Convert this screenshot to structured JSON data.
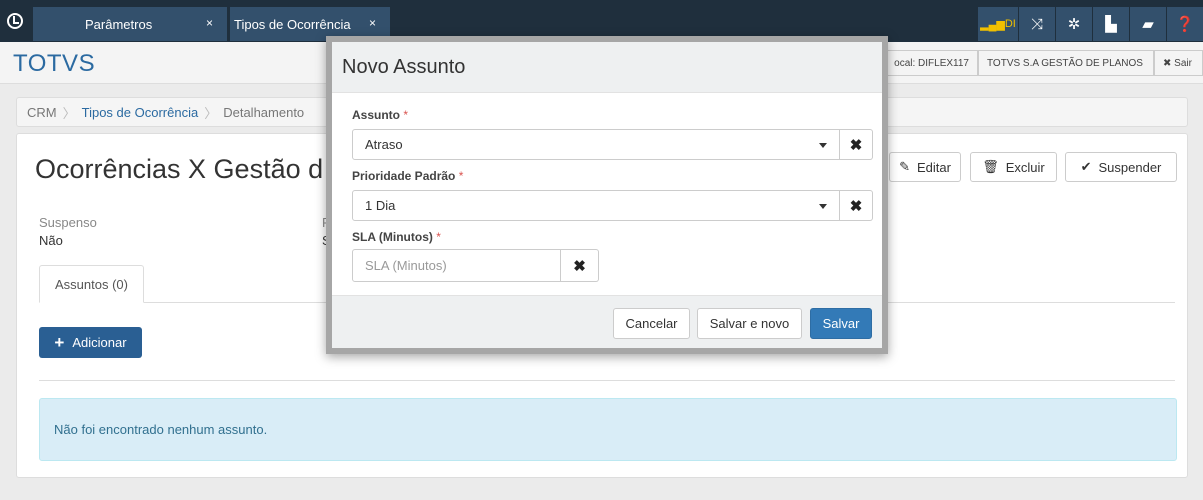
{
  "topbar": {
    "tabs": [
      {
        "label": "Parâmetros",
        "close": "×"
      },
      {
        "label": "Tipos de Ocorrência",
        "close": "×"
      }
    ],
    "icons": [
      "signal-icon",
      "shuffle-icon",
      "gear-icon",
      "document-icon",
      "chat-icon",
      "help-icon"
    ],
    "signal_label": "DI"
  },
  "header": {
    "brand": "TOTVS",
    "local": "ocal: DIFLEX117",
    "company": "TOTVS S.A GESTÃO DE PLANOS",
    "logout": "✖ Sair"
  },
  "breadcrumb": {
    "items": [
      "CRM",
      "Tipos de Ocorrência",
      "Detalhamento"
    ]
  },
  "page": {
    "title": "Ocorrências X Gestão d",
    "edit_label": "Editar",
    "delete_label": "Excluir",
    "suspend_label": "Suspender",
    "field1_label": "Suspenso",
    "field1_value": "Não",
    "field2_label": "R",
    "field2_value": "S",
    "subtab_label": "Assuntos (0)",
    "add_label": "Adicionar",
    "empty_message": "Não foi encontrado nenhum assunto."
  },
  "modal": {
    "title": "Novo Assunto",
    "subject_label": "Assunto",
    "subject_value": "Atraso",
    "priority_label": "Prioridade Padrão",
    "priority_value": "1 Dia",
    "sla_label": "SLA (Minutos)",
    "sla_placeholder": "SLA (Minutos)",
    "required_mark": "*",
    "clear_glyph": "✖",
    "cancel_label": "Cancelar",
    "save_new_label": "Salvar e novo",
    "save_label": "Salvar"
  },
  "colors": {
    "topbar": "#1f2f3d",
    "tab": "#33506c",
    "brand": "#2b6aa1",
    "primary": "#337ab7",
    "alert_bg": "#d9edf7",
    "required": "#d9534f"
  }
}
